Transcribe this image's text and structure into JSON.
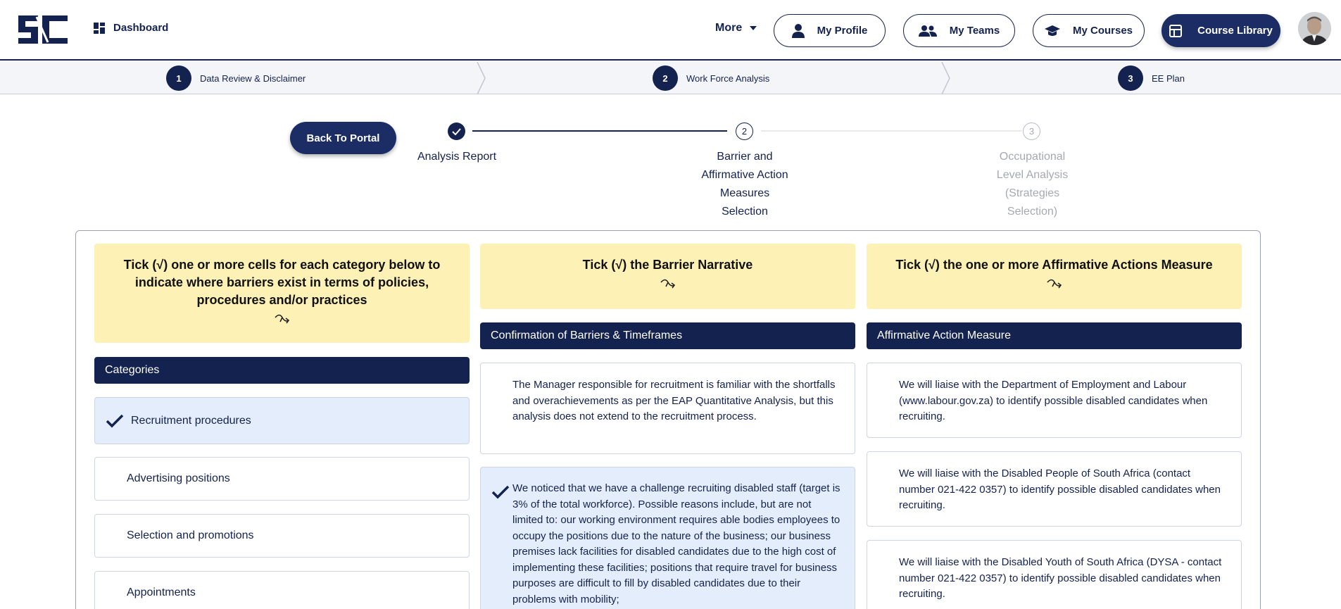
{
  "nav": {
    "dashboard_label": "Dashboard",
    "more_label": "More",
    "buttons": {
      "profile": "My Profile",
      "teams": "My Teams",
      "courses": "My Courses",
      "library": "Course Library"
    }
  },
  "main_steps": [
    {
      "num": "1",
      "label": "Data Review & Disclaimer"
    },
    {
      "num": "2",
      "label": "Work Force Analysis"
    },
    {
      "num": "3",
      "label": "EE Plan"
    }
  ],
  "back_label": "Back To Portal",
  "progress": [
    {
      "num": "",
      "label": "Analysis Report",
      "state": "done"
    },
    {
      "num": "2",
      "label": "Barrier and Affirmative Action Measures Selection",
      "state": "active"
    },
    {
      "num": "3",
      "label": "Occupational Level Analysis (Strategies Selection)",
      "state": "pending"
    }
  ],
  "instructions": {
    "categories": "Tick (√) one or more cells for each category below to indicate where barriers exist in terms of policies, procedures and/or practices",
    "barrier": "Tick (√) the Barrier Narrative",
    "measure": "Tick (√) the one or more Affirmative Actions Measure"
  },
  "headers": {
    "categories": "Categories",
    "barrier": "Confirmation of Barriers & Timeframes",
    "measure": "Affirmative Action Measure"
  },
  "categories": [
    {
      "label": "Recruitment procedures",
      "selected": true
    },
    {
      "label": "Advertising positions",
      "selected": false
    },
    {
      "label": "Selection and promotions",
      "selected": false
    },
    {
      "label": "Appointments",
      "selected": false
    }
  ],
  "barriers": [
    {
      "text": "The Manager responsible for recruitment is familiar with the shortfalls and overachievements as per the EAP Quantitative Analysis, but this analysis does not extend to the recruitment process.",
      "selected": false
    },
    {
      "text": "We noticed that we have a challenge recruiting disabled staff (target is 3% of the total workforce). Possible reasons include, but are not limited to: our working environment requires able bodies employees to occupy the positions due to the nature of the business; our business premises lack facilities for disabled candidates due to the high cost of implementing these facilities; positions that require travel for business purposes are difficult to fill by disabled candidates due to their problems with mobility;",
      "selected": true
    }
  ],
  "measures": [
    {
      "text": "We will liaise with the Department of Employment and Labour (www.labour.gov.za) to identify possible disabled candidates when recruiting.",
      "selected": false
    },
    {
      "text": "We will liaise with the Disabled People of South Africa (contact number 021-422 0357) to identify possible disabled candidates when recruiting.",
      "selected": false
    },
    {
      "text": "We will liaise with the Disabled Youth of South Africa (DYSA - contact number 021-422 0357) to identify possible disabled candidates when recruiting.",
      "selected": false
    }
  ],
  "colors": {
    "navy": "#14224f",
    "highlight": "#fdf1b6",
    "selected_bg": "#e4edfb"
  }
}
